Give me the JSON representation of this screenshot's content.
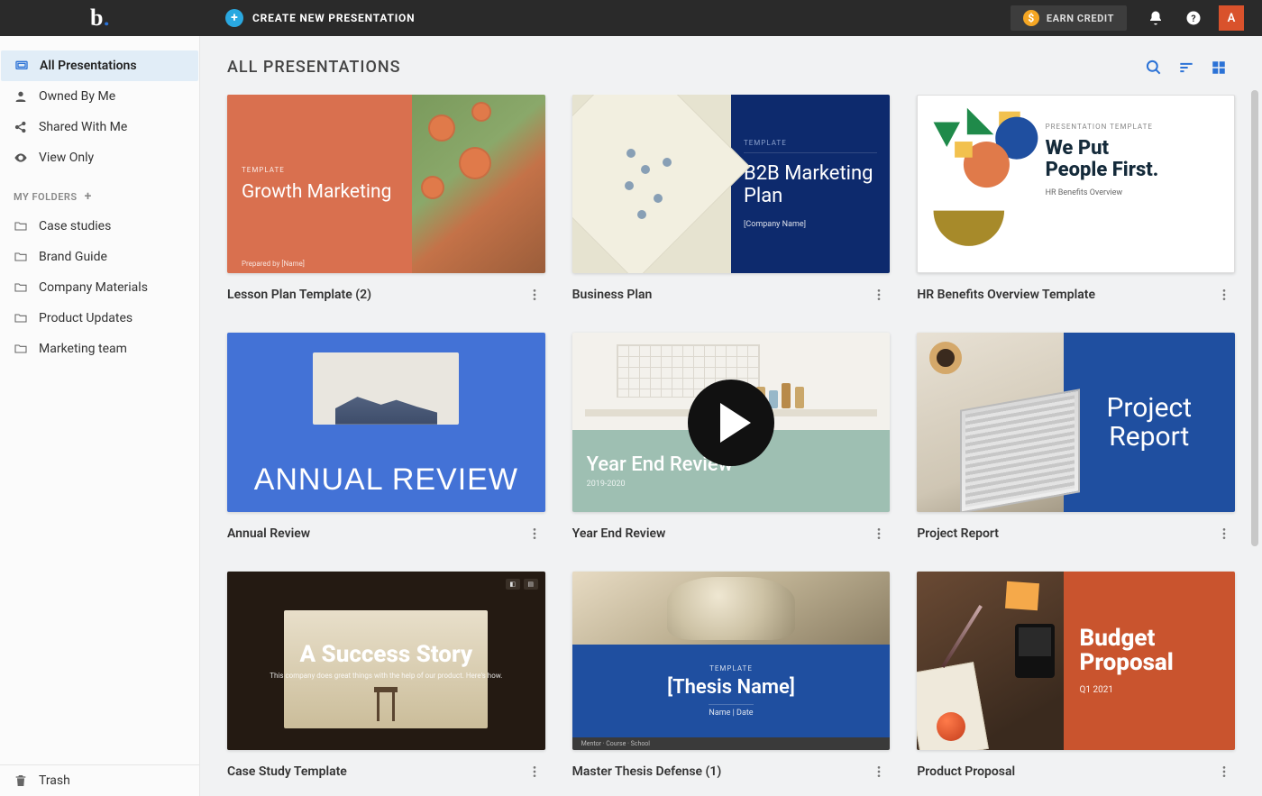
{
  "topbar": {
    "create_label": "CREATE NEW PRESENTATION",
    "earn_label": "EARN CREDIT",
    "avatar_initial": "A"
  },
  "sidebar": {
    "nav": [
      {
        "label": "All Presentations",
        "icon": "presentations-icon",
        "active": true
      },
      {
        "label": "Owned By Me",
        "icon": "person-icon"
      },
      {
        "label": "Shared With Me",
        "icon": "share-icon"
      },
      {
        "label": "View Only",
        "icon": "eye-icon"
      }
    ],
    "folders_header": "MY FOLDERS",
    "folders": [
      {
        "label": "Case studies"
      },
      {
        "label": "Brand Guide"
      },
      {
        "label": "Company Materials"
      },
      {
        "label": "Product Updates"
      },
      {
        "label": "Marketing team"
      }
    ],
    "trash_label": "Trash"
  },
  "main": {
    "title": "ALL PRESENTATIONS"
  },
  "cards": [
    {
      "title": "Lesson Plan Template (2)",
      "thumb": {
        "tag": "TEMPLATE",
        "heading": "Growth Marketing",
        "footer": "Prepared by [Name]"
      }
    },
    {
      "title": "Business Plan",
      "thumb": {
        "tag": "TEMPLATE",
        "heading": "B2B Marketing Plan",
        "footer": "[Company Name]"
      }
    },
    {
      "title": "HR Benefits Overview Template",
      "thumb": {
        "tag": "PRESENTATION TEMPLATE",
        "heading_l1": "We Put",
        "heading_l2": "People First.",
        "footer": "HR Benefits Overview"
      }
    },
    {
      "title": "Annual Review",
      "thumb": {
        "heading": "ANNUAL REVIEW"
      }
    },
    {
      "title": "Year End Review",
      "thumb": {
        "heading": "Year End Review",
        "footer": "2019-2020",
        "has_play": true
      }
    },
    {
      "title": "Project Report",
      "thumb": {
        "heading_l1": "Project",
        "heading_l2": "Report"
      }
    },
    {
      "title": "Case Study Template",
      "thumb": {
        "heading": "A Success Story",
        "footer": "This company does great things with the help of our product. Here's how.",
        "badge1": "◧",
        "badge2": "▤"
      }
    },
    {
      "title": "Master Thesis Defense (1)",
      "thumb": {
        "tag": "TEMPLATE",
        "heading": "[Thesis Name]",
        "footer": "Name  |  Date",
        "bottom": "Mentor · Course · School"
      }
    },
    {
      "title": "Product Proposal",
      "thumb": {
        "heading_l1": "Budget",
        "heading_l2": "Proposal",
        "footer": "Q1 2021"
      }
    }
  ]
}
